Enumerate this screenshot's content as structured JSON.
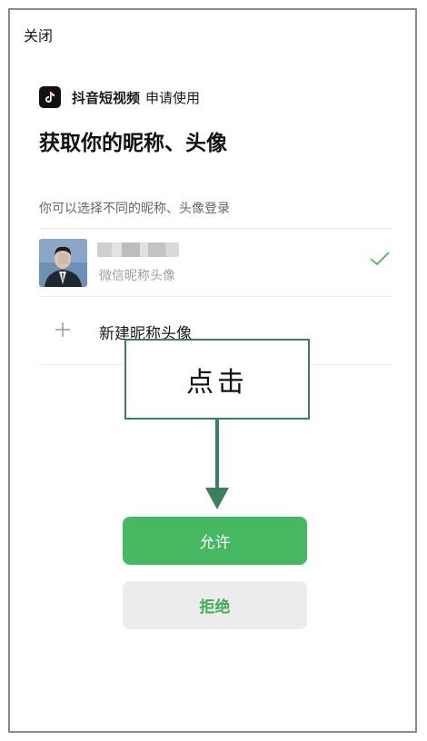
{
  "header": {
    "close_label": "关闭"
  },
  "app": {
    "name": "抖音短视频",
    "request_text": "申请使用",
    "logo_icon": "tiktok-note-icon"
  },
  "page": {
    "title": "获取你的昵称、头像"
  },
  "hint": "你可以选择不同的昵称、头像登录",
  "profile": {
    "subtitle": "微信昵称头像",
    "selected": true
  },
  "new_profile": {
    "label": "新建昵称头像"
  },
  "annotation": {
    "text": "点击"
  },
  "buttons": {
    "allow": "允许",
    "deny": "拒绝"
  },
  "colors": {
    "accent": "#45b861",
    "callout_border": "#3b7f61"
  }
}
